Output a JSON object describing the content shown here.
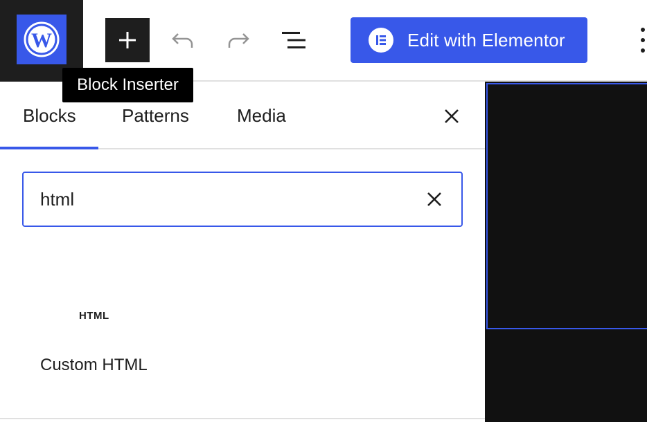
{
  "header": {
    "logo_icon": "wordpress-icon",
    "inserter_icon": "plus-icon",
    "undo_icon": "undo-icon",
    "redo_icon": "redo-icon",
    "list_view_icon": "list-view-icon",
    "elementor_button_label": "Edit with Elementor",
    "elementor_icon": "elementor-icon",
    "options_icon": "more-vertical-icon",
    "accent_color": "#3858e9"
  },
  "tooltip": {
    "text": "Block Inserter"
  },
  "inserter": {
    "tabs": [
      {
        "label": "Blocks",
        "active": true
      },
      {
        "label": "Patterns",
        "active": false
      },
      {
        "label": "Media",
        "active": false
      }
    ],
    "close_icon": "close-icon",
    "search": {
      "value": "html",
      "clear_icon": "close-icon"
    },
    "results": [
      {
        "icon_text": "HTML",
        "label": "Custom HTML"
      }
    ]
  }
}
